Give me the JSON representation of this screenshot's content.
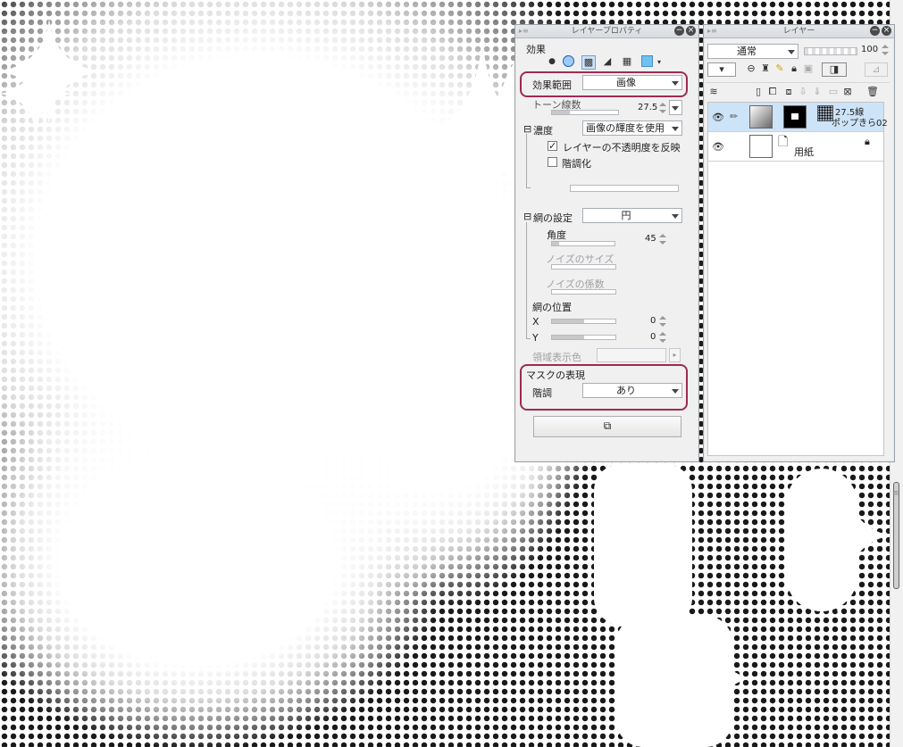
{
  "properties_panel": {
    "title": "レイヤープロパティ",
    "section_effect": "効果",
    "effect_range": {
      "label": "効果範囲",
      "value": "画像"
    },
    "tone_lines": {
      "label": "トーン線数",
      "value": "27.5"
    },
    "density": {
      "label": "濃度",
      "value": "画像の輝度を使用"
    },
    "reflect_opacity": {
      "label": "レイヤーの不透明度を反映",
      "checked": "✓"
    },
    "posterize": {
      "label": "階調化"
    },
    "screen_settings": {
      "label": "網の設定",
      "value": "円"
    },
    "angle": {
      "label": "角度",
      "value": "45"
    },
    "noise_size": {
      "label": "ノイズのサイズ"
    },
    "noise_factor": {
      "label": "ノイズの係数"
    },
    "screen_position": {
      "label": "網の位置"
    },
    "pos_x": {
      "label": "X",
      "value": "0"
    },
    "pos_y": {
      "label": "Y",
      "value": "0"
    },
    "area_color": {
      "label": "領域表示色"
    },
    "mask_expression": {
      "label": "マスクの表現"
    },
    "gradation": {
      "label": "階調",
      "value": "あり"
    }
  },
  "layers_panel": {
    "title": "レイヤー",
    "blend_mode": "通常",
    "opacity": "100",
    "layers": [
      {
        "name_line1": "27.5線",
        "name_line2": "ポップきら02"
      },
      {
        "name_line1": "用紙"
      }
    ]
  },
  "colors": {
    "highlight": "#9e2a52",
    "panel_bg": "#f0f0f0",
    "selected_layer": "#cde3f7"
  }
}
